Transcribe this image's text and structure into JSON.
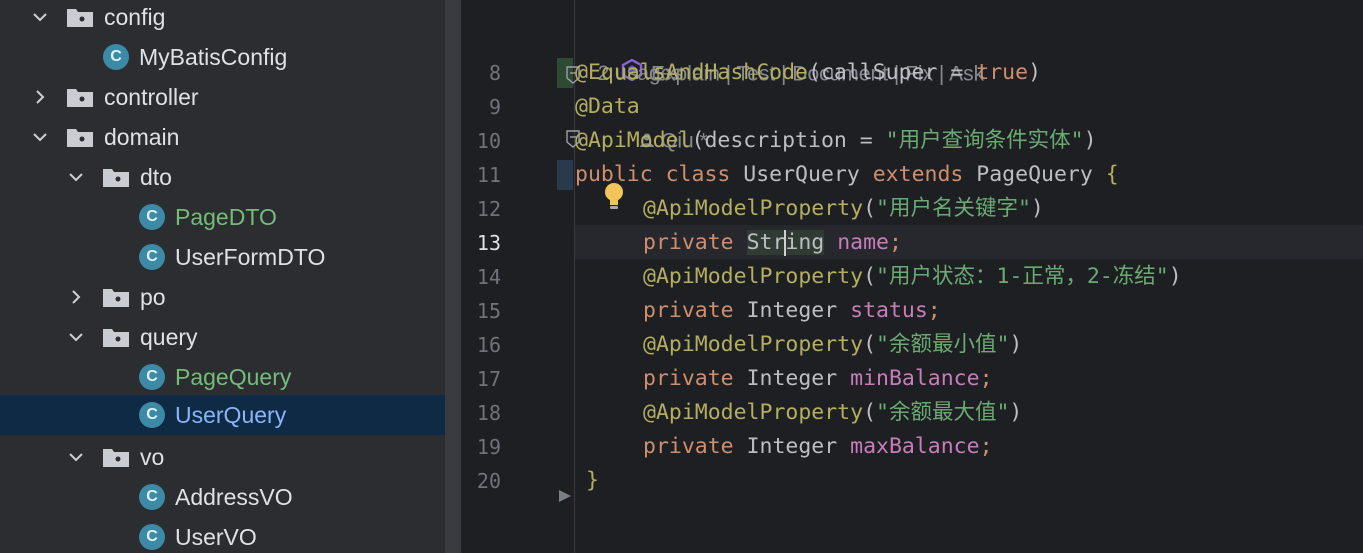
{
  "project_tree": {
    "items": [
      {
        "label": "config",
        "type": "folder",
        "expanded": true
      },
      {
        "label": "MyBatisConfig",
        "type": "class"
      },
      {
        "label": "controller",
        "type": "folder",
        "expanded": false
      },
      {
        "label": "domain",
        "type": "folder",
        "expanded": true
      },
      {
        "label": "dto",
        "type": "folder",
        "expanded": true
      },
      {
        "label": "PageDTO",
        "type": "class",
        "status": "new"
      },
      {
        "label": "UserFormDTO",
        "type": "class"
      },
      {
        "label": "po",
        "type": "folder",
        "expanded": false
      },
      {
        "label": "query",
        "type": "folder",
        "expanded": true
      },
      {
        "label": "PageQuery",
        "type": "class",
        "status": "new"
      },
      {
        "label": "UserQuery",
        "type": "class",
        "selected": true
      },
      {
        "label": "vo",
        "type": "folder",
        "expanded": true
      },
      {
        "label": "AddressVO",
        "type": "class"
      },
      {
        "label": "UserVO",
        "type": "class"
      }
    ]
  },
  "inlay": {
    "ai_actions": "Explain | Test | Document | Fix | Ask",
    "usages": "2 usages",
    "author": "Qiu *"
  },
  "editor": {
    "current_line": "13",
    "line_numbers": [
      "8",
      "9",
      "10",
      "11",
      "12",
      "13",
      "14",
      "15",
      "16",
      "17",
      "18",
      "19",
      "20"
    ],
    "code": {
      "l8_ann": "@EqualsAndHashCode",
      "l8_open": "(callSuper = ",
      "l8_val": "true",
      "l8_close": ")",
      "l9_ann": "@Data",
      "l10_ann": "@ApiModel",
      "l10_open": "(description = ",
      "l10_str": "\"用户查询条件实体\"",
      "l10_close": ")",
      "l11_kw1": "public class ",
      "l11_cls": "UserQuery ",
      "l11_kw2": "extends ",
      "l11_super": "PageQuery ",
      "l11_brace": "{",
      "l12_ann": "@ApiModelProperty",
      "l12_str": "\"用户名关键字\"",
      "l13_kw": "private ",
      "l13_type_a": "Str",
      "l13_type_b": "ing",
      "l13_field": "name",
      "l14_ann": "@ApiModelProperty",
      "l14_str": "\"用户状态：1-正常，2-冻结\"",
      "l15_kw": "private ",
      "l15_type": "Integer ",
      "l15_field": "status",
      "l16_ann": "@ApiModelProperty",
      "l16_str": "\"余额最小值\"",
      "l17_kw": "private ",
      "l17_type": "Integer ",
      "l17_field": "minBalance",
      "l18_ann": "@ApiModelProperty",
      "l18_str": "\"余额最大值\"",
      "l19_kw": "private ",
      "l19_type": "Integer ",
      "l19_field": "maxBalance",
      "l20_brace": "}"
    }
  },
  "colors": {
    "keyword": "#cf8e6d",
    "annotation": "#b3ae60",
    "string": "#6aab73",
    "field": "#c77dbb",
    "class_icon": "#3d8aa6",
    "selection": "#0f2a44"
  },
  "icons": [
    "chevron-down-icon",
    "chevron-right-icon",
    "folder-icon",
    "class-icon",
    "ai-assistant-icon",
    "user-icon",
    "lightbulb-icon",
    "fold-icon"
  ]
}
